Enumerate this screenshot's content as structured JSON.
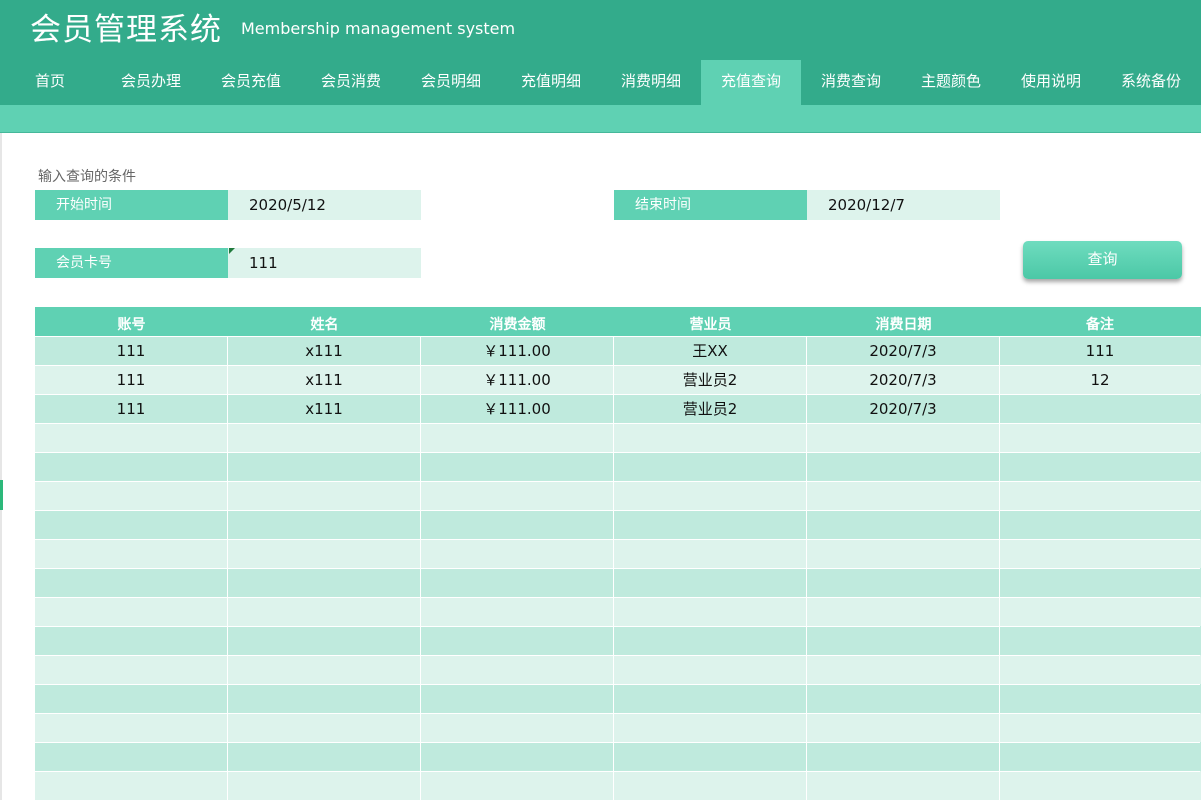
{
  "app": {
    "title": "会员管理系统",
    "subtitle": "Membership management system"
  },
  "nav": {
    "items": [
      "首页",
      "会员办理",
      "会员充值",
      "会员消费",
      "会员明细",
      "充值明细",
      "消费明细",
      "充值查询",
      "消费查询",
      "主题颜色",
      "使用说明",
      "系统备份"
    ],
    "active": "充值查询"
  },
  "form": {
    "caption": "输入查询的条件",
    "start_label": "开始时间",
    "start_value": "2020/5/12",
    "end_label": "结束时间",
    "end_value": "2020/12/7",
    "card_label": "会员卡号",
    "card_value": "111",
    "query_button": "查询"
  },
  "table": {
    "headers": [
      "账号",
      "姓名",
      "消费金额",
      "营业员",
      "消费日期",
      "备注"
    ],
    "rows": [
      [
        "111",
        "x111",
        "￥111.00",
        "王XX",
        "2020/7/3",
        "111"
      ],
      [
        "111",
        "x111",
        "￥111.00",
        "营业员2",
        "2020/7/3",
        "12"
      ],
      [
        "111",
        "x111",
        "￥111.00",
        "营业员2",
        "2020/7/3",
        ""
      ]
    ],
    "total_rows": 16
  },
  "colors": {
    "header_bg": "#33ab8b",
    "accent": "#5fd1b3",
    "row_dark": "#bfeadd",
    "row_light": "#ddf3ec"
  }
}
